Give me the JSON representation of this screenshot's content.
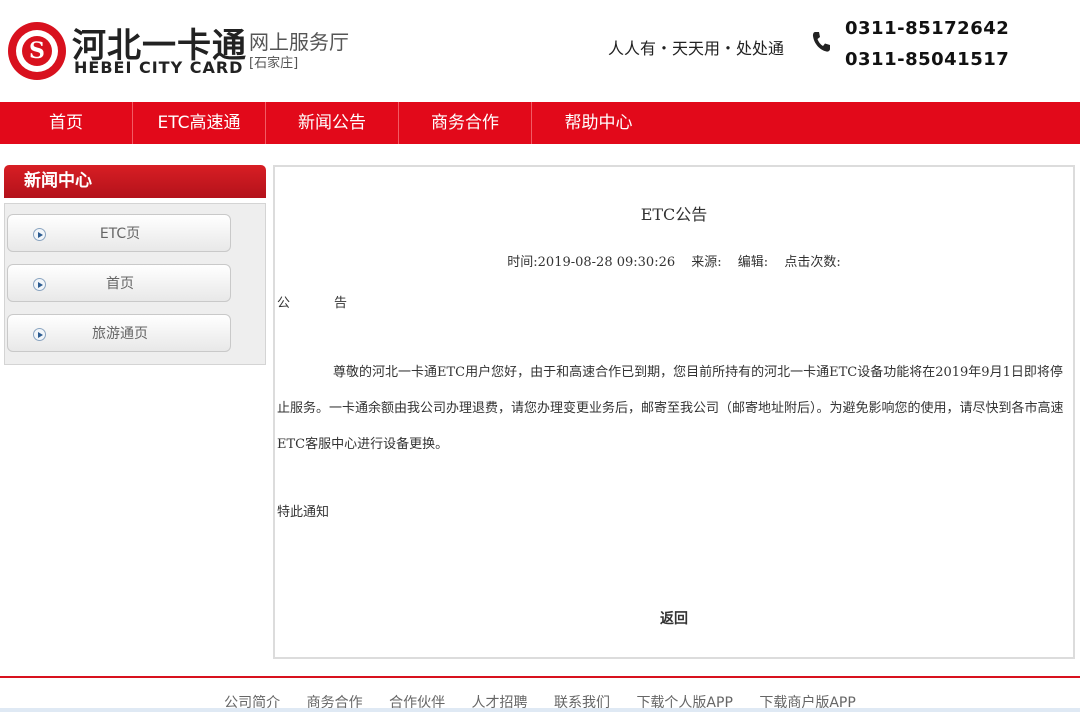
{
  "header": {
    "logo_cn": "河北一卡通",
    "logo_en": "HEBEI CITY CARD",
    "hall_title": "网上服务厅",
    "city": "[石家庄]",
    "slogan": "人人有・天天用・处处通",
    "phone1": "0311-85172642",
    "phone2": "0311-85041517",
    "brand_color": "#e2091a"
  },
  "nav": {
    "items": [
      {
        "label": "首页"
      },
      {
        "label": "ETC高速通"
      },
      {
        "label": "新闻公告"
      },
      {
        "label": "商务合作"
      },
      {
        "label": "帮助中心"
      }
    ]
  },
  "sidebar": {
    "title": "新闻中心",
    "items": [
      {
        "label": "ETC页"
      },
      {
        "label": "首页"
      },
      {
        "label": "旅游通页"
      }
    ]
  },
  "article": {
    "title": "ETC公告",
    "time": "时间:2019-08-28 09:30:26",
    "source": "来源:",
    "editor": "编辑:",
    "clicks": "点击次数:",
    "heading_a": "公",
    "heading_b": "告",
    "body": "尊敬的河北一卡通ETC用户您好，由于和高速合作已到期，您目前所持有的河北一卡通ETC设备功能将在2019年9月1日即将停止服务。一卡通余额由我公司办理退费，请您办理变更业务后，邮寄至我公司（邮寄地址附后）。为避免影响您的使用，请尽快到各市高速ETC客服中心进行设备更换。",
    "sign": "特此通知",
    "back_label": "返回"
  },
  "footer": {
    "links": [
      {
        "label": "公司简介"
      },
      {
        "label": "商务合作"
      },
      {
        "label": "合作伙伴"
      },
      {
        "label": "人才招聘"
      },
      {
        "label": "联系我们"
      },
      {
        "label": "下载个人版APP"
      },
      {
        "label": "下载商户版APP"
      }
    ]
  }
}
